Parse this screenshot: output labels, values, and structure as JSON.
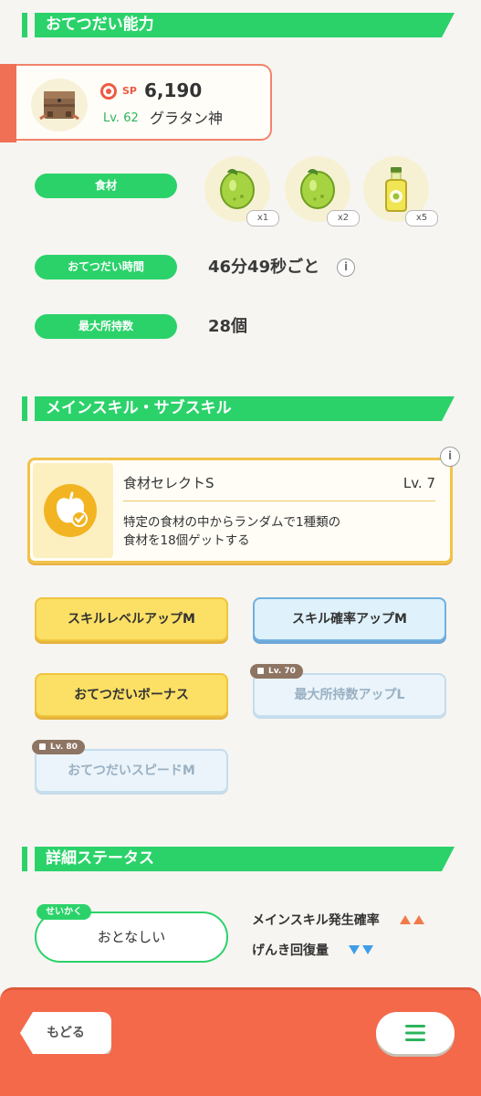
{
  "sections": {
    "help_ability": "おてつだい能力",
    "skills": "メインスキル・サブスキル",
    "details": "詳細ステータス"
  },
  "pokemon": {
    "sp_label": "SP",
    "sp_value": "6,190",
    "level": "Lv. 62",
    "name": "グラタン神",
    "avatar_icon": "pokemon-avatar-icon"
  },
  "stats": {
    "ingredients_label": "食材",
    "ingredients": [
      {
        "icon": "bean-icon",
        "count": "x1"
      },
      {
        "icon": "bean-icon",
        "count": "x2"
      },
      {
        "icon": "oil-bottle-icon",
        "count": "x5"
      }
    ],
    "help_time_label": "おてつだい時間",
    "help_time_value": "46分49秒ごと",
    "max_carry_label": "最大所持数",
    "max_carry_value": "28個"
  },
  "main_skill": {
    "name": "食材セレクトS",
    "level": "Lv. 7",
    "description_line1": "特定の食材の中からランダムで1種類の",
    "description_line2": "食材を18個ゲットする",
    "icon": "apple-check-icon"
  },
  "sub_skills": [
    {
      "label": "スキルレベルアップM",
      "style": "gold",
      "lock": ""
    },
    {
      "label": "スキル確率アップM",
      "style": "blue",
      "lock": ""
    },
    {
      "label": "おてつだいボーナス",
      "style": "gold",
      "lock": ""
    },
    {
      "label": "最大所持数アップL",
      "style": "locked",
      "lock": "Lv. 70"
    },
    {
      "label": "おてつだいスピードM",
      "style": "locked",
      "lock": "Lv. 80"
    }
  ],
  "nature": {
    "tag": "せいかく",
    "value": "おとなしい",
    "up_stat": "メインスキル発生確率",
    "down_stat": "げんき回復量",
    "colors": {
      "up": "#f07a4a",
      "down": "#3f9ee8"
    }
  },
  "nav": {
    "back_label": "もどる",
    "menu_icon": "menu-icon"
  },
  "colors": {
    "accent_green": "#2bd26a",
    "bottom_bar": "#f3694a",
    "skill_gold": "#f2c24a"
  }
}
